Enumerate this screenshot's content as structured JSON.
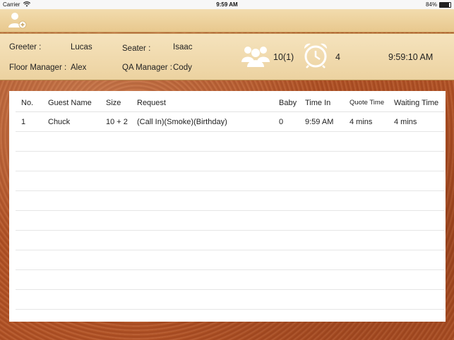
{
  "status_bar": {
    "carrier": "Carrier",
    "time": "9:59 AM",
    "battery": "84%"
  },
  "info": {
    "greeter_label": "Greeter :",
    "greeter_value": "Lucas",
    "seater_label": "Seater :",
    "seater_value": "Isaac",
    "floor_manager_label": "Floor Manager :",
    "floor_manager_value": "Alex",
    "qa_manager_label": "QA Manager :",
    "qa_manager_value": "Cody",
    "party_count": "10(1)",
    "waiting_count": "4",
    "clock": "9:59:10 AM"
  },
  "table": {
    "headers": {
      "no": "No.",
      "guest_name": "Guest Name",
      "size": "Size",
      "request": "Request",
      "baby": "Baby",
      "time_in": "Time In",
      "quote_time": "Quote Time",
      "waiting_time": "Waiting Time"
    },
    "rows": [
      {
        "no": "1",
        "guest_name": "Chuck",
        "size": "10 + 2",
        "request": "(Call In)(Smoke)(Birthday)",
        "baby": "0",
        "time_in": "9:59 AM",
        "quote_time": "4 mins",
        "waiting_time": "4 mins"
      }
    ]
  },
  "icons": {
    "add_user": "add-user-icon",
    "party": "people-icon",
    "alarm": "alarm-clock-icon",
    "wifi": "wifi-icon",
    "battery": "battery-icon"
  }
}
